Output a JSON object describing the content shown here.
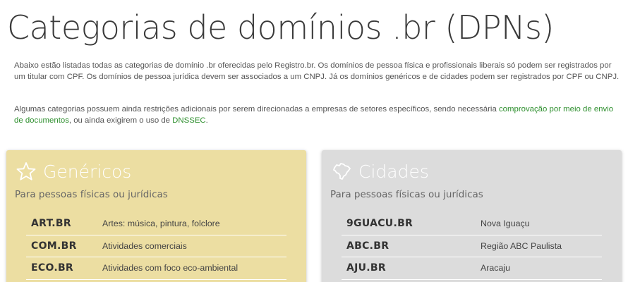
{
  "page": {
    "title": "Categorias de domínios .br (DPNs)",
    "intro_text": "Abaixo estão listadas todas as categorias de domínio .br oferecidas pelo Registro.br. Os domínios de pessoa física e profissionais liberais só podem ser registrados por um titular com CPF. Os domínios de pessoa jurídica devem ser associados a um CNPJ. Já os domínios genéricos e de cidades podem ser registrados por CPF ou CNPJ.",
    "restrictions": {
      "prefix": "Algumas categorias possuem ainda restrições adicionais por serem direcionadas a empresas de setores específicos, sendo necessária ",
      "link1": "comprovação por meio de envio de documentos",
      "middle": ", ou ainda exigirem o uso de ",
      "link2": "DNSSEC",
      "suffix": "."
    },
    "link_color": "#2e8f2e"
  },
  "cards": [
    {
      "title": "Genéricos",
      "icon": "star-icon",
      "subtitle": "Para pessoas físicas ou jurídicas",
      "background": "#ecdea2",
      "rows": [
        {
          "domain": "ART.BR",
          "description": "Artes: música, pintura, folclore"
        },
        {
          "domain": "COM.BR",
          "description": "Atividades comerciais"
        },
        {
          "domain": "ECO.BR",
          "description": "Atividades com foco eco-ambiental"
        }
      ]
    },
    {
      "title": "Cidades",
      "icon": "brazil-map-icon",
      "subtitle": "Para pessoas físicas ou jurídicas",
      "background": "#dcdcdc",
      "rows": [
        {
          "domain": "9GUACU.BR",
          "description": "Nova Iguaçu"
        },
        {
          "domain": "ABC.BR",
          "description": "Região ABC Paulista"
        },
        {
          "domain": "AJU.BR",
          "description": "Aracaju"
        }
      ]
    }
  ]
}
